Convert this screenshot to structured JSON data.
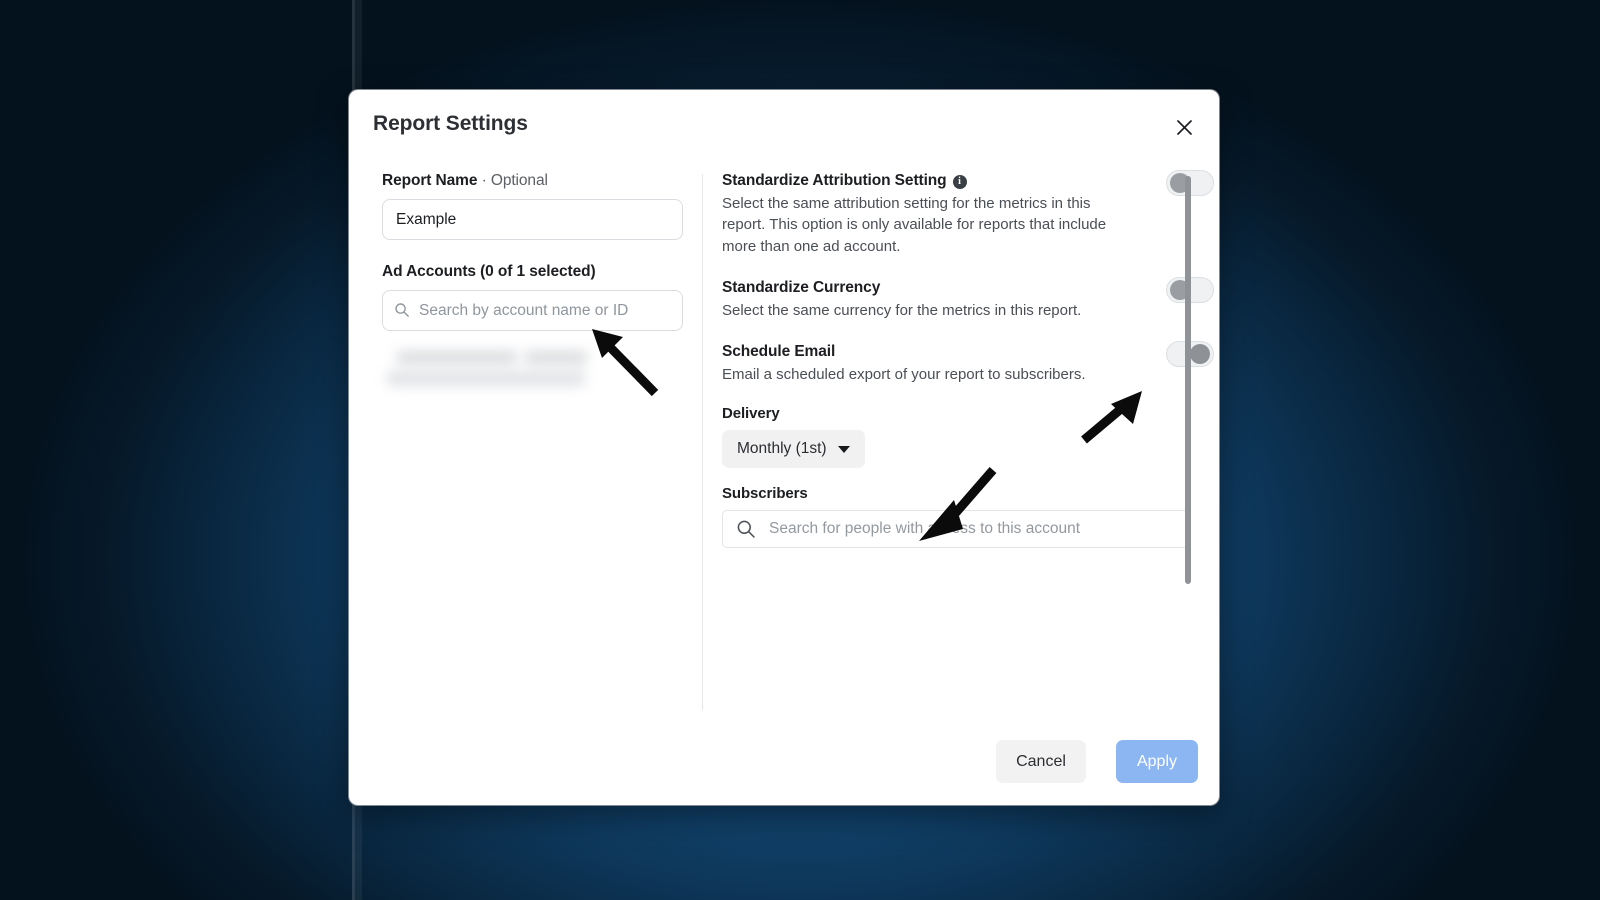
{
  "dialog": {
    "title": "Report Settings",
    "close_icon": "close-icon"
  },
  "left_panel": {
    "report_name": {
      "label": "Report Name",
      "separator": "·",
      "optional": "Optional",
      "value": "Example",
      "placeholder": ""
    },
    "ad_accounts": {
      "label": "Ad Accounts (0 of 1 selected)",
      "search_placeholder": "Search by account name or ID",
      "search_icon": "search-icon",
      "redacted_result": ""
    }
  },
  "right_panel": {
    "settings": [
      {
        "title": "Standardize Attribution Setting",
        "info_icon": "info-icon",
        "info_glyph": "i",
        "description": "Select the same attribution setting for the metrics in this report. This option is only available for reports that include more than one ad account.",
        "toggle_state": "off"
      },
      {
        "title": "Standardize Currency",
        "description": "Select the same currency for the metrics in this report.",
        "toggle_state": "off"
      },
      {
        "title": "Schedule Email",
        "description": "Email a scheduled export of your report to subscribers.",
        "toggle_state": "on"
      }
    ],
    "delivery": {
      "label": "Delivery",
      "selected": "Monthly (1st)",
      "caret_icon": "chevron-down-icon"
    },
    "subscribers": {
      "label": "Subscribers",
      "placeholder": "Search for people with access to this account",
      "search_icon": "search-icon"
    }
  },
  "footer": {
    "cancel_label": "Cancel",
    "apply_label": "Apply"
  },
  "colors": {
    "apply_button": "#8cb6f2",
    "cancel_button": "#f2f2f3",
    "text_primary": "#1c1e21",
    "text_secondary": "#4a4f55",
    "backdrop": "#103f67"
  }
}
